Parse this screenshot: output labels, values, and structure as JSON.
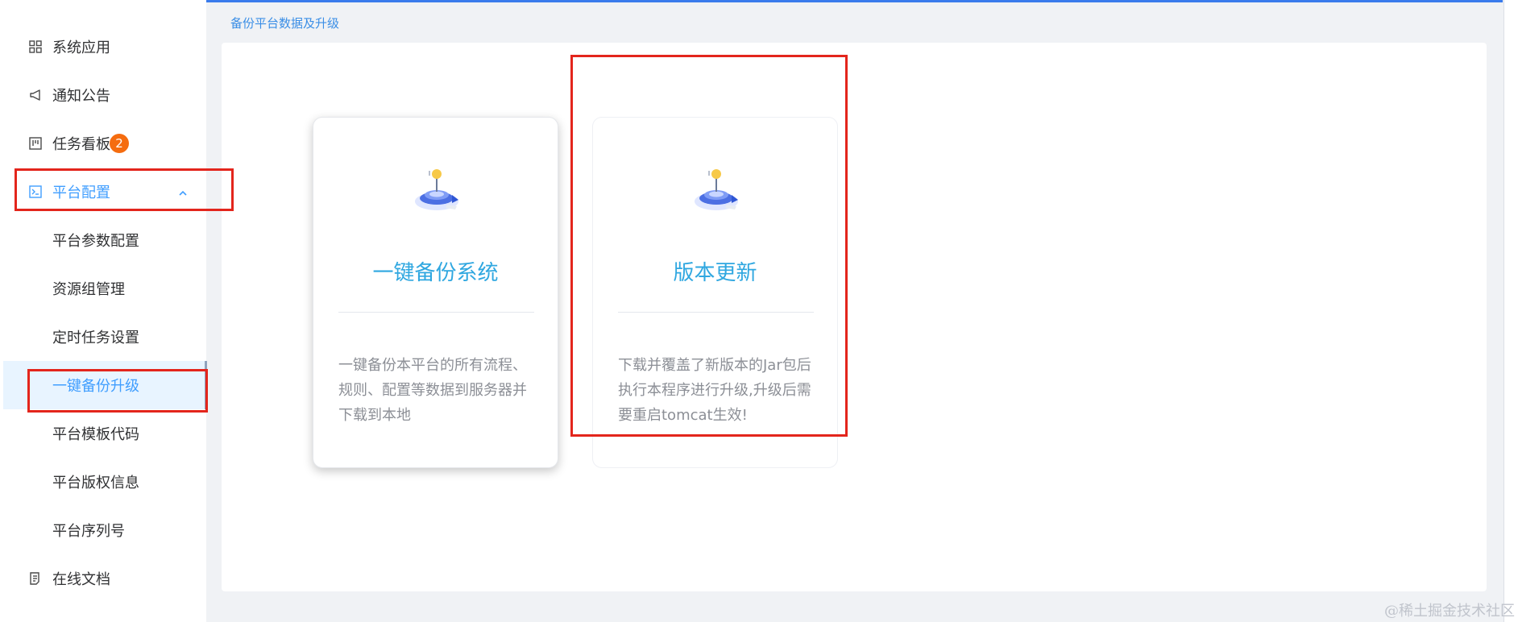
{
  "breadcrumb": "备份平台数据及升级",
  "sidebar": {
    "items": [
      {
        "label": "系统应用",
        "icon": "grid-icon"
      },
      {
        "label": "通知公告",
        "icon": "megaphone-icon"
      },
      {
        "label": "任务看板",
        "icon": "kanban-icon",
        "badge": "2"
      },
      {
        "label": "平台配置",
        "icon": "terminal-icon",
        "expanded": true
      }
    ],
    "submenu": [
      {
        "label": "平台参数配置"
      },
      {
        "label": "资源组管理"
      },
      {
        "label": "定时任务设置"
      },
      {
        "label": "一键备份升级",
        "selected": true
      },
      {
        "label": "平台模板代码"
      },
      {
        "label": "平台版权信息"
      },
      {
        "label": "平台序列号"
      }
    ],
    "bottom_item": {
      "label": "在线文档",
      "icon": "document-icon"
    }
  },
  "cards": [
    {
      "title": "一键备份系统",
      "description": "一键备份本平台的所有流程、规则、配置等数据到服务器并下载到本地",
      "icon": "backup-illustration-icon"
    },
    {
      "title": "版本更新",
      "description": "下载并覆盖了新版本的Jar包后执行本程序进行升级,升级后需要重启tomcat生效!",
      "icon": "update-illustration-icon"
    }
  ],
  "watermark": "@稀土掘金技术社区",
  "colors": {
    "accent": "#409eff",
    "card_title": "#2fa7e0",
    "badge": "#f56c0f",
    "highlight_box": "#e3251c",
    "top_bar": "#3a7bec"
  }
}
